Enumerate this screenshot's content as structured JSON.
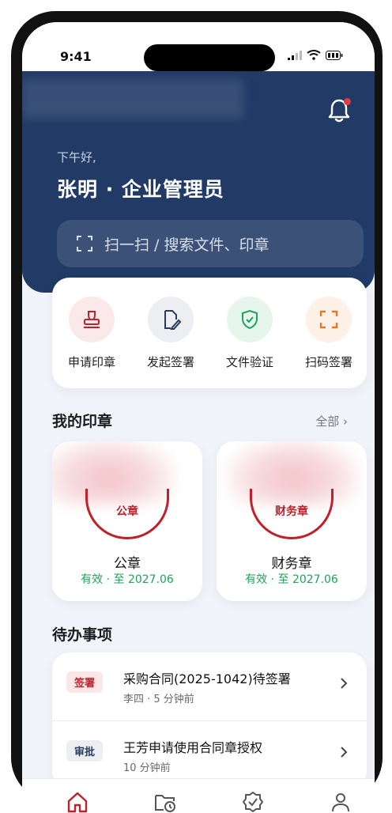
{
  "status_bar": {
    "time": "9:41"
  },
  "header": {
    "greeting": "下午好,",
    "user": "张明 · 企业管理员",
    "search_placeholder": "扫一扫 / 搜索文件、印章"
  },
  "quick_actions": [
    {
      "label": "申请印章",
      "icon": "seal-stamp-icon",
      "color": "#c0202a",
      "bg": "#fbe9ea"
    },
    {
      "label": "发起签署",
      "icon": "document-sign-icon",
      "color": "#2a3d5e",
      "bg": "#eceef2"
    },
    {
      "label": "文件验证",
      "icon": "shield-check-icon",
      "color": "#1fa35b",
      "bg": "#e6f6ec"
    },
    {
      "label": "扫码签署",
      "icon": "scan-frame-icon",
      "color": "#e07b2a",
      "bg": "#fdf0e6"
    }
  ],
  "seals_section": {
    "title": "我的印章",
    "more": "全部",
    "items": [
      {
        "stamp_text": "公章",
        "name": "公章",
        "status": "有效 · 至 2027.06"
      },
      {
        "stamp_text": "财务章",
        "name": "财务章",
        "status": "有效 · 至 2027.06"
      }
    ]
  },
  "todo_section": {
    "title": "待办事项",
    "items": [
      {
        "badge": "签署",
        "badge_color": "#c0202a",
        "badge_bg": "#fbe6e8",
        "title": "采购合同(2025-1042)待签署",
        "meta": "李四 · 5 分钟前"
      },
      {
        "badge": "审批",
        "badge_color": "#2a3d5e",
        "badge_bg": "#eceef2",
        "title": "王芳申请使用合同章授权",
        "meta": "10 分钟前"
      }
    ]
  },
  "tab_bar": [
    {
      "icon": "home-icon",
      "active": true
    },
    {
      "icon": "folder-clock-icon",
      "active": false
    },
    {
      "icon": "badge-check-icon",
      "active": false
    },
    {
      "icon": "user-icon",
      "active": false
    }
  ],
  "colors": {
    "primary": "#213a66",
    "accent_red": "#c0202a",
    "success": "#1fa35b"
  }
}
